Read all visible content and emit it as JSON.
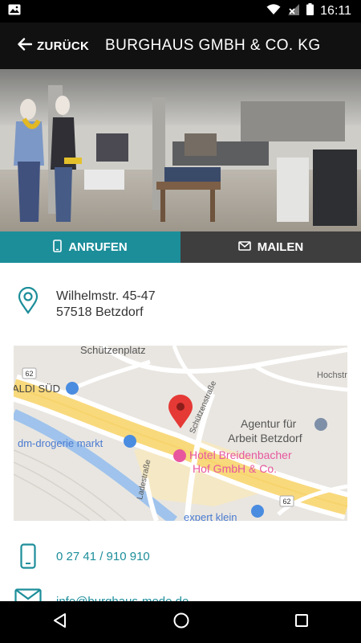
{
  "status_bar": {
    "time": "16:11"
  },
  "app_bar": {
    "back_label": "ZURÜCK",
    "title": "BURGHAUS GMBH & CO. KG"
  },
  "actions": {
    "call_label": "ANRUFEN",
    "mail_label": "MAILEN"
  },
  "address": {
    "line1": "Wilhelmstr. 45-47",
    "line2": "57518 Betzdorf"
  },
  "map": {
    "labels": {
      "schuetzenplatz": "Schützenplatz",
      "hochstr": "Hochstra",
      "aldi": "ALDI SÜD",
      "dm": "dm-drogerie markt",
      "schuetzenstr": "Schützenstraße",
      "agentur1": "Agentur für",
      "agentur2": "Arbeit Betzdorf",
      "hotel1": "Hotel Breidenbacher",
      "hotel2": "Hof GmbH & Co.",
      "ladestr": "Ladestraße",
      "expert": "expert klein",
      "road62a": "62",
      "road62b": "62"
    }
  },
  "contact": {
    "phone": "0 27 41 / 910 910",
    "email": "info@burghaus-mode.de"
  },
  "colors": {
    "accent": "#1c8e9a",
    "appbar": "#111111",
    "mail_button": "#3e3e3e",
    "marker": "#e53935"
  }
}
